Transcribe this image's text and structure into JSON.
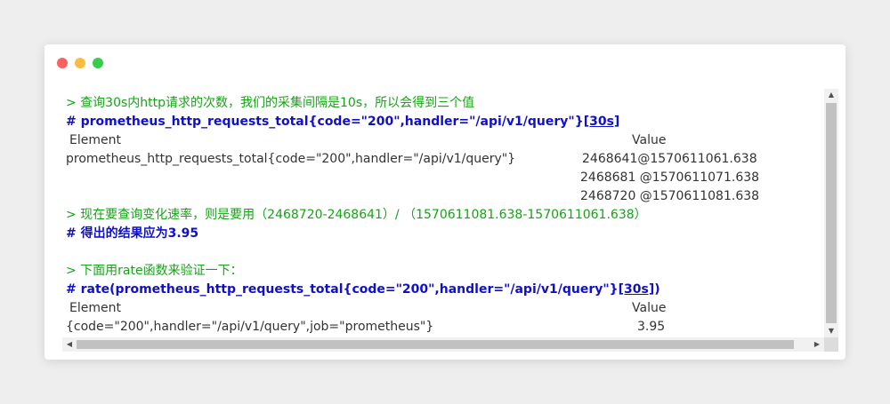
{
  "lines": {
    "l1": "> 查询30s内http请求的次数，我们的采集间隔是10s，所以会得到三个值",
    "l2_main": "# prometheus_http_requests_total{code=\"200\",handler=\"/api/v1/query\"}",
    "l2_range": "[30s]",
    "l3_element": "Element",
    "l3_value": "Value",
    "l4_element": "prometheus_http_requests_total{code=\"200\",handler=\"/api/v1/query\"}",
    "l4_value": "2468641@1570611061.638",
    "l5_value": "2468681 @1570611071.638",
    "l6_value": "2468720 @1570611081.638",
    "l7": "> 现在要查询变化速率，则是要用（2468720-2468641）/ （1570611081.638-1570611061.638）",
    "l8": "# 得出的结果应为3.95",
    "l10": "> 下面用rate函数来验证一下：",
    "l11_main": "#  rate(prometheus_http_requests_total{code=\"200\",handler=\"/api/v1/query\"}",
    "l11_range": "[30s]",
    "l11_close": ")",
    "l12_element": "Element",
    "l12_value": "Value",
    "l13_element": "{code=\"200\",handler=\"/api/v1/query\",job=\"prometheus\"}",
    "l13_value": "3.95"
  },
  "scrollbar": {
    "up_arrow": "▲",
    "down_arrow": "▼",
    "left_arrow": "◀",
    "right_arrow": "▶"
  },
  "colors": {
    "close": "#fc625d",
    "minimize": "#fdbc40",
    "maximize": "#35cd4b",
    "comment_green": "#17a317",
    "query_blue": "#1010c8"
  }
}
